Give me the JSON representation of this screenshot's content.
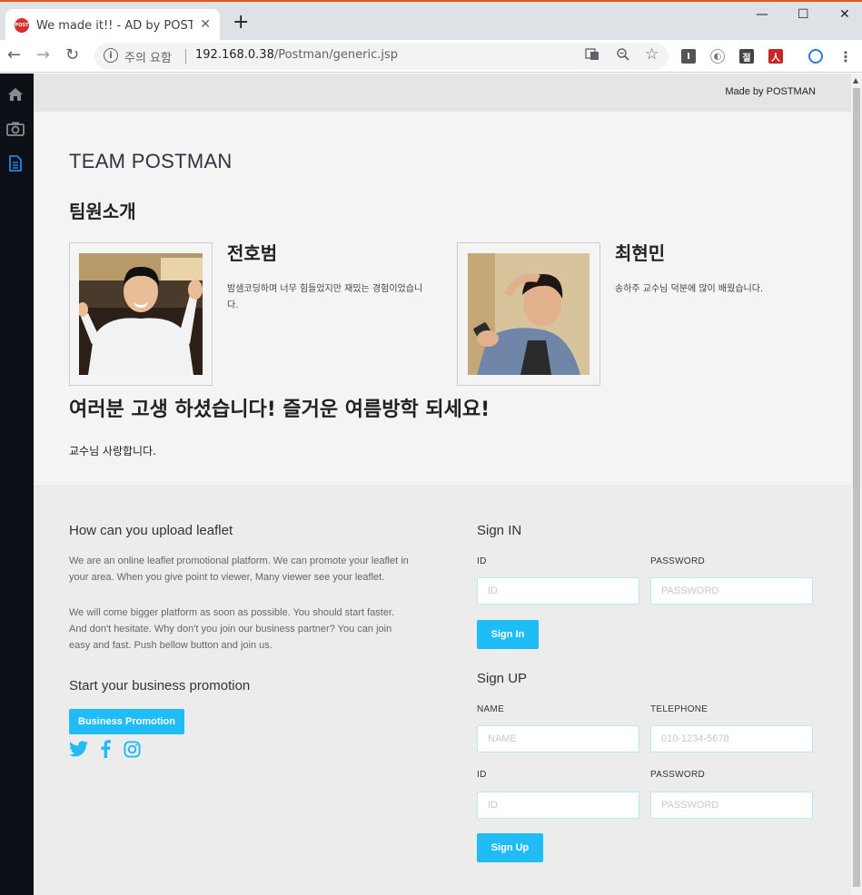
{
  "browser": {
    "tab_favicon_text": "POST",
    "tab_title": "We made it!! - AD by POSTMAN",
    "security_label": "주의 요함",
    "url_host": "192.168.0.38",
    "url_path": "/Postman/generic.jsp"
  },
  "header": {
    "made_by": "Made by POSTMAN"
  },
  "content": {
    "team_title": "TEAM POSTMAN",
    "intro_title": "팀원소개",
    "members": [
      {
        "name": "전호범",
        "description": "밤샘코딩하며 너무 힘들었지만 재밌는 경험이었습니다."
      },
      {
        "name": "최현민",
        "description": "송하주 교수님 덕분에 많이 배웠습니다."
      }
    ],
    "cheer": "여러분 고생 하셨습니다! 즐거운 여름방학 되세요!",
    "love": "교수님 사랑합니다."
  },
  "footer": {
    "upload_title": "How can you upload leaflet",
    "para1": "We are an online leaflet promotional platform. We can promote your leaflet in your area. When you give point to viewer, Many viewer see your leaflet.",
    "para2": "We will come bigger platform as soon as possible. You should start faster. And don't hesitate. Why don't you join our business partner? You can join easy and fast. Push bellow button and join us.",
    "promo_title": "Start your business promotion",
    "promo_button": "Business Promotion",
    "signin": {
      "title": "Sign IN",
      "id_label": "ID",
      "id_placeholder": "ID",
      "password_label": "PASSWORD",
      "password_placeholder": "PASSWORD",
      "button": "Sign In"
    },
    "signup": {
      "title": "Sign UP",
      "name_label": "NAME",
      "name_placeholder": "NAME",
      "tel_label": "TELEPHONE",
      "tel_placeholder": "010-1234-5678",
      "id_label": "ID",
      "id_placeholder": "ID",
      "password_label": "PASSWORD",
      "password_placeholder": "PASSWORD",
      "button": "Sign Up"
    }
  },
  "colors": {
    "accent": "#1fbcf6",
    "sidebar": "#0d1117",
    "active_icon": "#1e88e5"
  }
}
